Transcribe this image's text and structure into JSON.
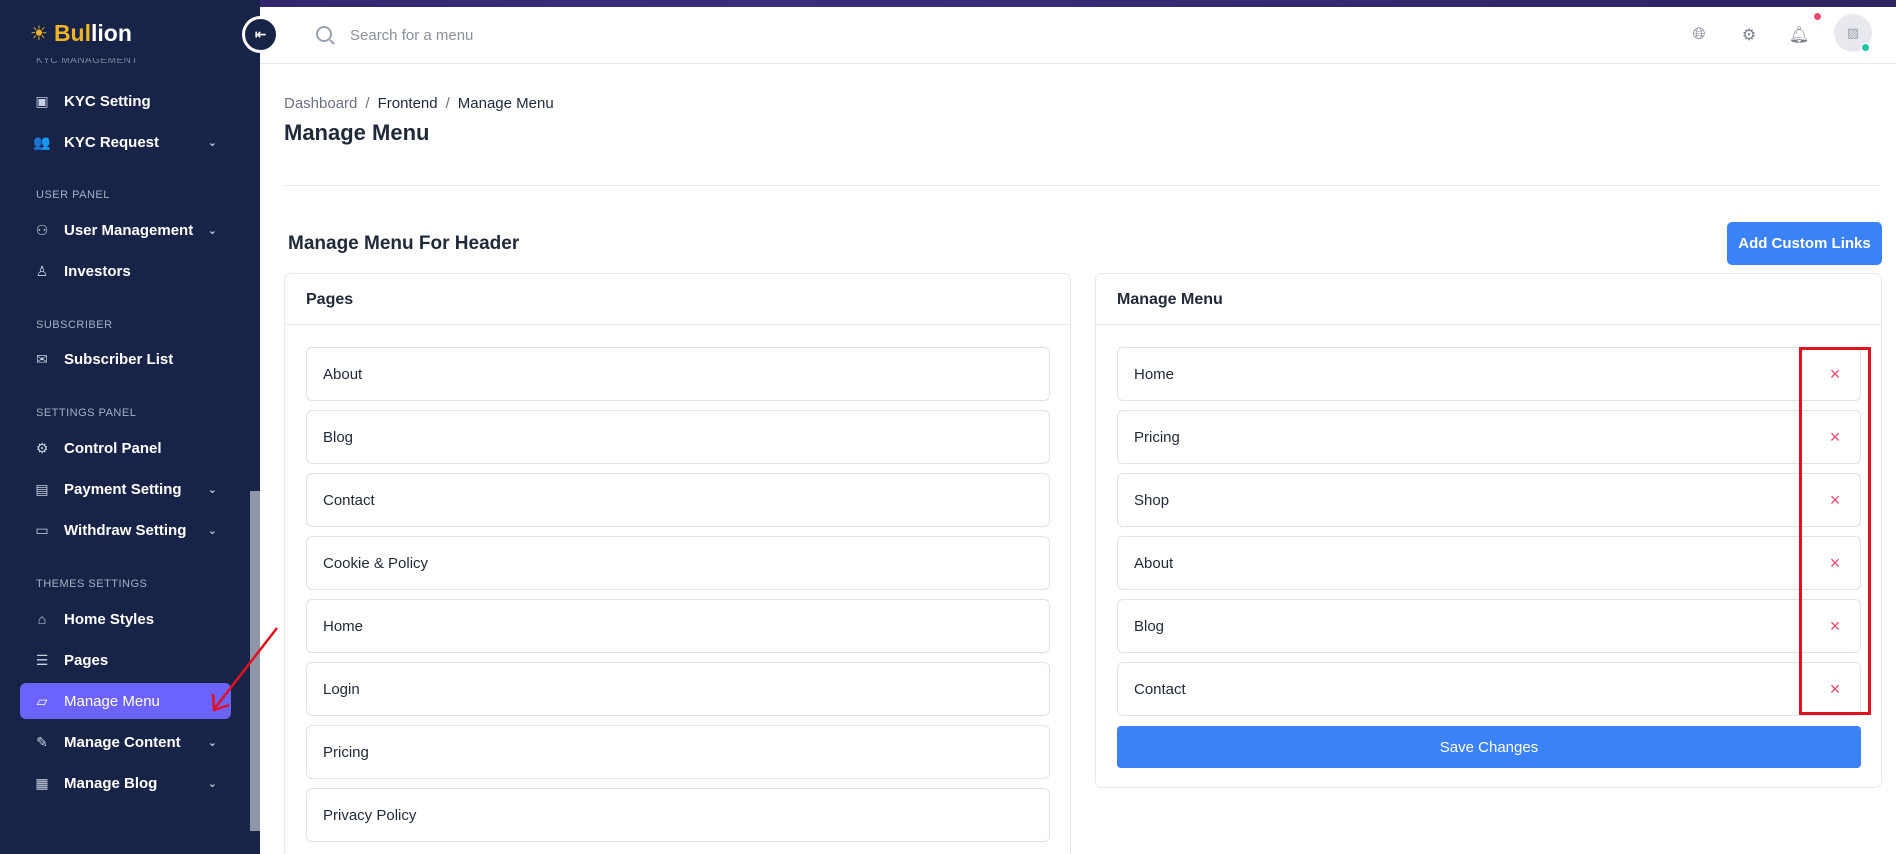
{
  "app": {
    "logo_part1": "Bul",
    "logo_part2": "lion",
    "logo_mark": "☀"
  },
  "sidebar": {
    "truncated_section": "KYC MANAGEMENT",
    "sections": [
      {
        "label": "USER PANEL"
      },
      {
        "label": "SUBSCRIBER"
      },
      {
        "label": "SETTINGS PANEL"
      },
      {
        "label": "THEMES SETTINGS"
      }
    ],
    "items": [
      {
        "label": "KYC Setting",
        "icon": "kyc-setting-icon"
      },
      {
        "label": "KYC Request",
        "icon": "kyc-request-icon",
        "expandable": true
      },
      {
        "label": "User Management",
        "icon": "users-icon",
        "expandable": true
      },
      {
        "label": "Investors",
        "icon": "investor-icon"
      },
      {
        "label": "Subscriber List",
        "icon": "mail-open-icon"
      },
      {
        "label": "Control Panel",
        "icon": "gear-icon"
      },
      {
        "label": "Payment Setting",
        "icon": "briefcase-icon",
        "expandable": true
      },
      {
        "label": "Withdraw Setting",
        "icon": "wallet-icon",
        "expandable": true
      },
      {
        "label": "Home Styles",
        "icon": "home-gear-icon"
      },
      {
        "label": "Pages",
        "icon": "list-icon"
      },
      {
        "label": "Manage Menu",
        "icon": "folder-icon",
        "active": true
      },
      {
        "label": "Manage Content",
        "icon": "pencil-icon",
        "expandable": true
      },
      {
        "label": "Manage Blog",
        "icon": "newspaper-icon",
        "expandable": true
      }
    ]
  },
  "header": {
    "search_placeholder": "Search for a menu"
  },
  "breadcrumb": [
    "Dashboard",
    "Frontend",
    "Manage Menu"
  ],
  "page_title": "Manage Menu",
  "section_title": "Manage Menu For Header",
  "add_custom_links_label": "Add Custom Links",
  "pages_card": {
    "title": "Pages",
    "items": [
      "About",
      "Blog",
      "Contact",
      "Cookie & Policy",
      "Home",
      "Login",
      "Pricing",
      "Privacy Policy"
    ]
  },
  "menu_card": {
    "title": "Manage Menu",
    "items": [
      "Home",
      "Pricing",
      "Shop",
      "About",
      "Blog",
      "Contact"
    ],
    "remove_glyph": "×",
    "save_label": "Save Changes"
  },
  "colors": {
    "sidebar_bg": "#182447",
    "active_item": "#6c63ff",
    "primary_button": "#3b82f6",
    "remove_icon": "#ef4a6d",
    "annotation": "#e0121f"
  }
}
